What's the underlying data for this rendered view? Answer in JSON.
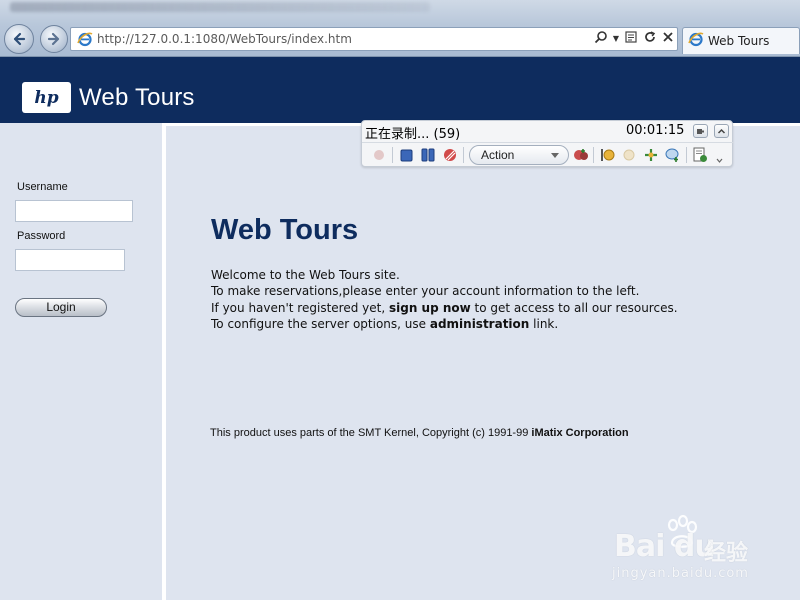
{
  "browser": {
    "url": "http://127.0.0.1:1080/WebTours/index.htm",
    "tab_title": "Web Tours"
  },
  "header": {
    "logo_text": "hp",
    "site_title": "Web Tours"
  },
  "sidebar": {
    "username_label": "Username",
    "username_value": "",
    "password_label": "Password",
    "password_value": "",
    "login_label": "Login"
  },
  "recorder": {
    "status": "正在录制... (59)",
    "timer": "00:01:15",
    "action_selected": "Action"
  },
  "main": {
    "heading": "Web Tours",
    "line1": "Welcome to the Web Tours site.",
    "line2": "To make reservations,please enter your account information to the left.",
    "line3_pre": "If you haven't registered yet, ",
    "line3_link": "sign up now",
    "line3_post": " to get access to all our resources.",
    "line4_pre": "To configure the server options, use ",
    "line4_link": "administration",
    "line4_post": " link.",
    "copyright_pre": "This product uses parts of the SMT Kernel, Copyright (c) 1991-99 ",
    "copyright_bold": "iMatix Corporation"
  },
  "watermark": {
    "brand": "Bai du",
    "cn": "经验",
    "domain": "jingyan.baidu.com"
  }
}
